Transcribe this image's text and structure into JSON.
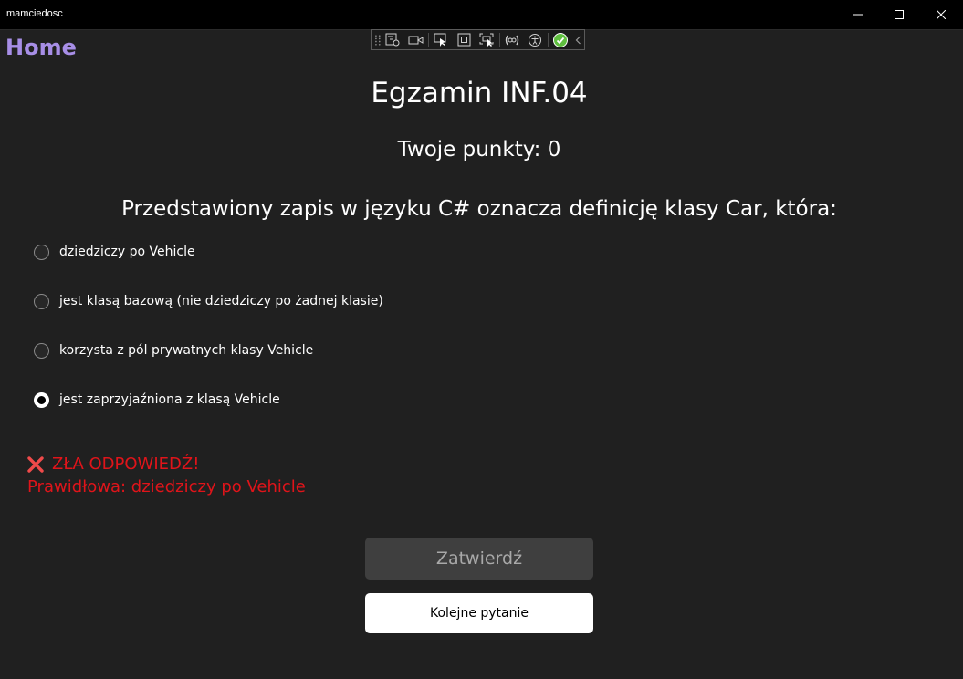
{
  "window": {
    "title": "mamciedosc",
    "controls": [
      "minimize-icon",
      "maximize-icon",
      "close-icon"
    ]
  },
  "nav": {
    "home": "Home"
  },
  "devtoolbar": {
    "icons": [
      "grip-icon",
      "live-visual-tree-icon",
      "record-icon",
      "select-element-icon",
      "display-layout-adorners-icon",
      "track-focus-icon",
      "binding-failures-icon",
      "accessibility-checker-icon",
      "check-circle-icon",
      "collapse-chevron-icon"
    ],
    "check_color": "#5fbf3f"
  },
  "exam": {
    "title": "Egzamin INF.04",
    "score": "Twoje punkty: 0",
    "question": "Przedstawiony zapis w języku C# oznacza definicję klasy Car, która:",
    "options": [
      {
        "label": "dziedziczy po Vehicle",
        "selected": false
      },
      {
        "label": "jest klasą bazową (nie dziedziczy po żadnej klasie)",
        "selected": false
      },
      {
        "label": "korzysta z pól prywatnych klasy Vehicle",
        "selected": false
      },
      {
        "label": "jest zaprzyjaźniona z klasą Vehicle",
        "selected": true
      }
    ]
  },
  "feedback": {
    "icon": "cross-icon",
    "wrong": "ZŁA ODPOWIEDŹ!",
    "correct": "Prawidłowa: dziedziczy po Vehicle",
    "color": "#e0141a"
  },
  "buttons": {
    "confirm": "Zatwierdź",
    "next": "Kolejne pytanie"
  },
  "colors": {
    "background": "#202020",
    "home_link": "#a78ee6",
    "confirm_bg": "#3f3f3f",
    "next_bg": "#ffffff"
  }
}
